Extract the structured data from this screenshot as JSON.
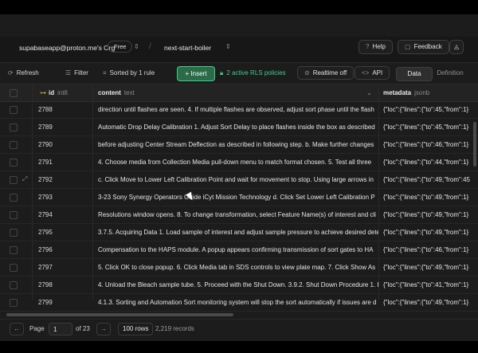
{
  "header": {
    "org": "supabaseapp@proton.me's Org",
    "plan": "Free",
    "project": "next-start-boiler",
    "help": "Help",
    "feedback": "Feedback"
  },
  "toolbar": {
    "refresh": "Refresh",
    "filter": "Filter",
    "sorted": "Sorted by 1 rule",
    "insert": "Insert",
    "rls": "2 active RLS policies",
    "realtime": "Realtime off",
    "api": "API",
    "data_tab": "Data",
    "definition_tab": "Definition"
  },
  "columns": [
    {
      "name": "id",
      "type": "int8"
    },
    {
      "name": "content",
      "type": "text"
    },
    {
      "name": "metadata",
      "type": "jsonb"
    }
  ],
  "rows": [
    {
      "id": "2788",
      "content": "direction until flashes are seen. 4. If multiple flashes are observed, adjust sort phase until the flash",
      "metadata": "{\"loc\":{\"lines\":{\"to\":45,\"from\":1}"
    },
    {
      "id": "2789",
      "content": "Automatic Drop Delay Calibration 1. Adjust Sort Delay to place flashes inside the box as described",
      "metadata": "{\"loc\":{\"lines\":{\"to\":45,\"from\":1}"
    },
    {
      "id": "2790",
      "content": "before adjusting Center Stream Deflection as described in following step. b. Make further changes",
      "metadata": "{\"loc\":{\"lines\":{\"to\":46,\"from\":1}"
    },
    {
      "id": "2791",
      "content": "4. Choose media from Collection Media pull-down menu to match format chosen. 5. Test all three",
      "metadata": "{\"loc\":{\"lines\":{\"to\":44,\"from\":1}"
    },
    {
      "id": "2792",
      "content": "c. Click Move to Lower Left Calibration Point and wait for movement to stop. Using large arrows in",
      "metadata": "{\"loc\":{\"lines\":{\"to\":49,\"from\":45"
    },
    {
      "id": "2793",
      "content": "3-23 Sony Synergy Operators Guide iCyt Mission Technology d. Click Set Lower Left Calibration P",
      "metadata": "{\"loc\":{\"lines\":{\"to\":49,\"from\":1}"
    },
    {
      "id": "2794",
      "content": "Resolutions window opens. 8. To change transformation, select Feature Name(s) of interest and cli",
      "metadata": "{\"loc\":{\"lines\":{\"to\":49,\"from\":1}"
    },
    {
      "id": "2795",
      "content": "3.7.5. Acquiring Data 1. Load sample of interest and adjust sample pressure to achieve desired dete",
      "metadata": "{\"loc\":{\"lines\":{\"to\":49,\"from\":1}"
    },
    {
      "id": "2796",
      "content": "Compensation to the HAPS module. A popup appears confirming transmission of sort gates to HA",
      "metadata": "{\"loc\":{\"lines\":{\"to\":46,\"from\":1}"
    },
    {
      "id": "2797",
      "content": "5. Click OK to close popup. 6. Click Media tab in SDS controls to view plate map. 7. Click Show As",
      "metadata": "{\"loc\":{\"lines\":{\"to\":49,\"from\":1}"
    },
    {
      "id": "2798",
      "content": "4. Unload the Bleach sample tube. 5. Proceed with the Shut Down. 3.9.2. Shut Down Procedure 1. E",
      "metadata": "{\"loc\":{\"lines\":{\"to\":41,\"from\":1}"
    },
    {
      "id": "2799",
      "content": "4.1.3. Sorting and Automation Sort monitoring system will stop the sort automatically if issues are d",
      "metadata": "{\"loc\":{\"lines\":{\"to\":49,\"from\":1}"
    }
  ],
  "footer": {
    "page_label": "Page",
    "page_value": "1",
    "of_pages": "of 23",
    "rows_per_page": "100 rows",
    "records": "2,219 records"
  }
}
